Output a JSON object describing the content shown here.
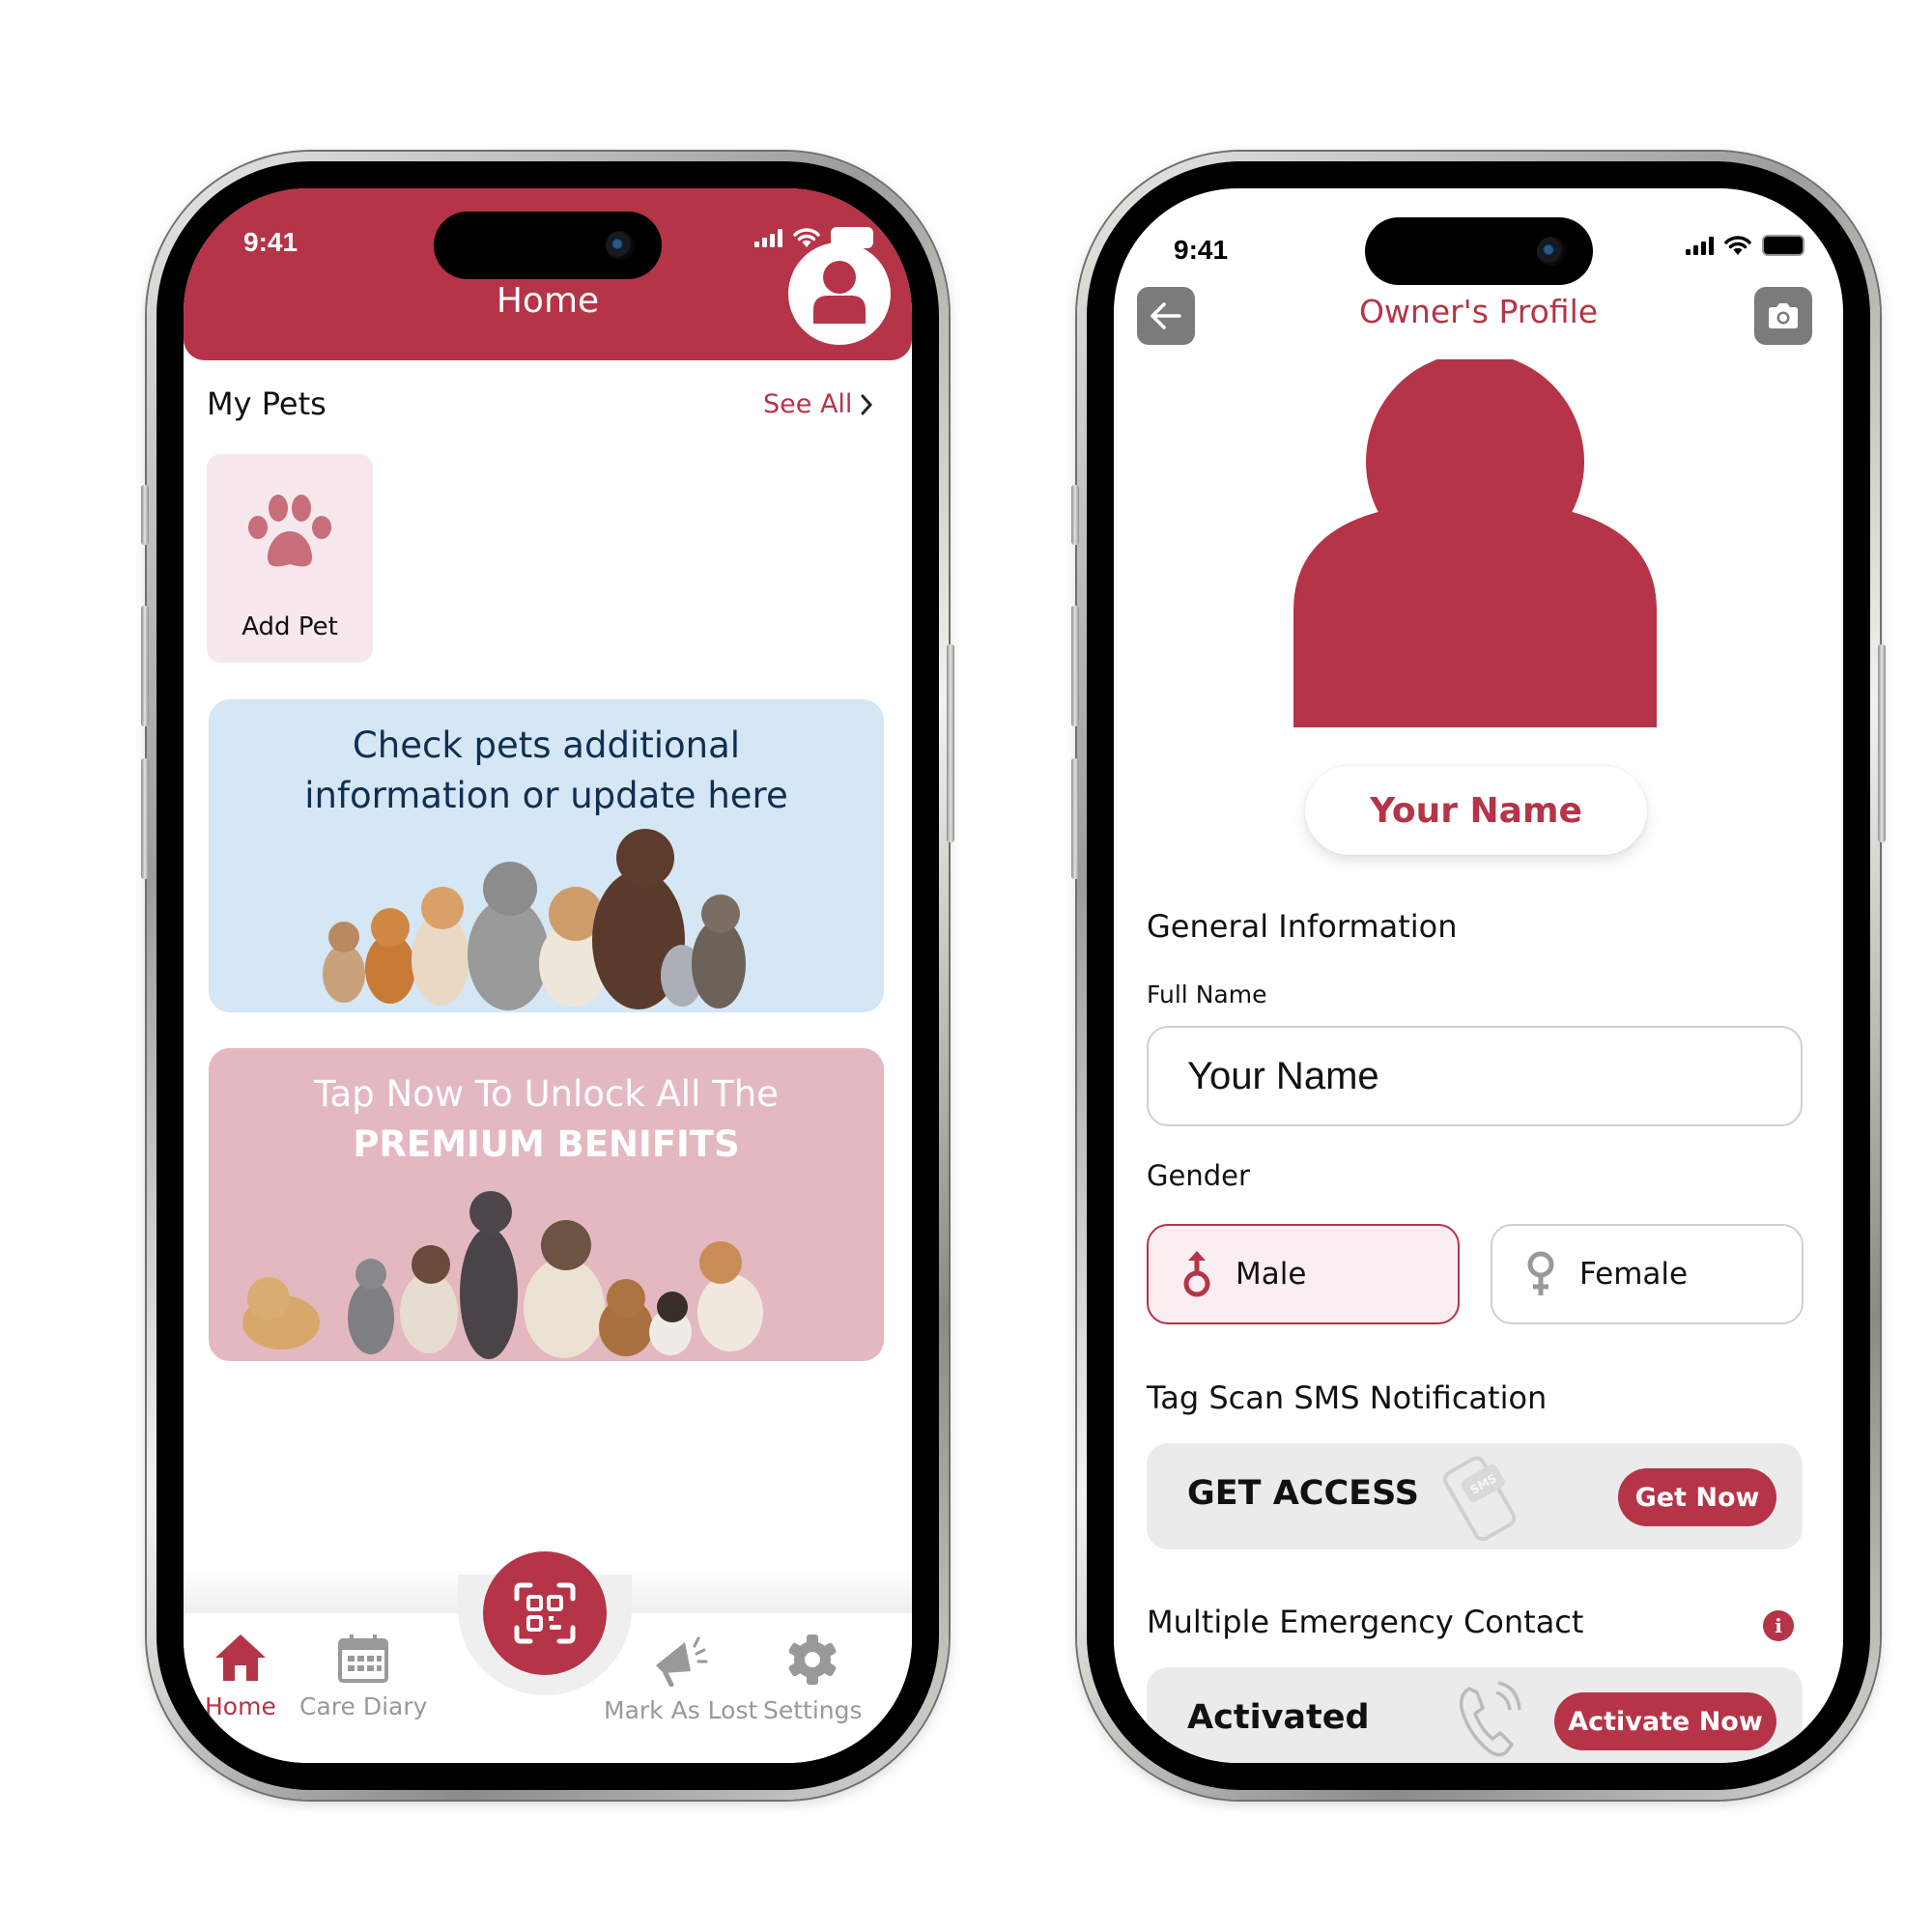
{
  "colors": {
    "brand": "#b53447",
    "brand_light": "#f6e8ec",
    "info_card_bg": "#d5e6f4",
    "info_card_text": "#0e2f52",
    "premium_card_bg": "#e4b8c1",
    "inactive_icon": "#999999"
  },
  "home_screen": {
    "status_bar": {
      "time": "9:41"
    },
    "header": {
      "title": "Home",
      "profile_icon": "user-avatar-icon"
    },
    "my_pets": {
      "title": "My Pets",
      "see_all_label": "See All",
      "add_pet": {
        "label": "Add Pet",
        "icon": "paw-icon"
      }
    },
    "info_card": {
      "line1": "Check pets additional",
      "line2": "information or update here"
    },
    "premium_card": {
      "line1": "Tap Now To Unlock All The",
      "line2": "PREMIUM BENIFITS"
    },
    "tab_bar": {
      "center_button_icon": "qr-scan-icon",
      "tabs": [
        {
          "label": "Home",
          "icon": "home-icon",
          "active": true
        },
        {
          "label": "Care Diary",
          "icon": "calendar-icon",
          "active": false
        },
        {
          "label": "Mark As Lost",
          "icon": "megaphone-icon",
          "active": false
        },
        {
          "label": "Settings",
          "icon": "gear-icon",
          "active": false
        }
      ]
    }
  },
  "profile_screen": {
    "status_bar": {
      "time": "9:41"
    },
    "header": {
      "title": "Owner's Profile",
      "back_icon": "arrow-left-icon",
      "camera_icon": "camera-icon"
    },
    "name_display": "Your Name",
    "general_information": {
      "title": "General Information",
      "full_name_label": "Full Name",
      "full_name_value": "Your Name"
    },
    "gender": {
      "label": "Gender",
      "options": [
        {
          "label": "Male",
          "icon": "male-symbol-icon",
          "selected": true
        },
        {
          "label": "Female",
          "icon": "female-symbol-icon",
          "selected": false
        }
      ]
    },
    "sms_notification": {
      "title": "Tag Scan SMS Notification",
      "status": "GET ACCESS",
      "button_label": "Get Now",
      "icon": "sms-phone-icon"
    },
    "emergency_contact": {
      "title": "Multiple Emergency Contact",
      "info_icon": "i",
      "status": "Activated",
      "button_label": "Activate Now",
      "icon": "phone-ringing-icon"
    }
  }
}
